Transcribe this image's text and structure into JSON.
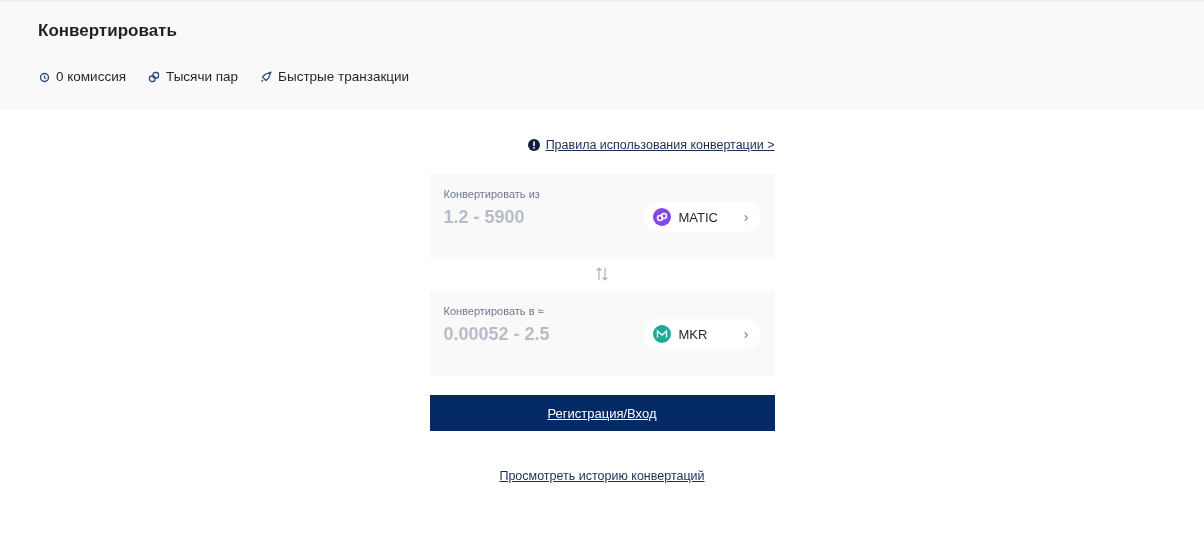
{
  "header": {
    "title": "Конвертировать",
    "features": [
      {
        "kind": "clock",
        "label": "0 комиссия"
      },
      {
        "kind": "link",
        "label": "Тысячи пар"
      },
      {
        "kind": "rocket",
        "label": "Быстрые транзакции"
      }
    ]
  },
  "rules_link": "Правила использования конвертации >",
  "cards": [
    {
      "label": "Конвертировать из",
      "placeholder": "1.2 - 5900",
      "coin": {
        "kind": "matic",
        "symbol": "MATIC",
        "color": "#8247e5"
      },
      "chevron": "›"
    },
    {
      "label": "Конвертировать в ≈",
      "placeholder": "0.00052 - 2.5",
      "coin": {
        "kind": "mkr",
        "symbol": "MKR",
        "color": "#1aab9b"
      },
      "chevron": "›"
    }
  ],
  "submit_button": "Регистрация/Вход",
  "history_link": "Просмотреть историю конвертаций"
}
